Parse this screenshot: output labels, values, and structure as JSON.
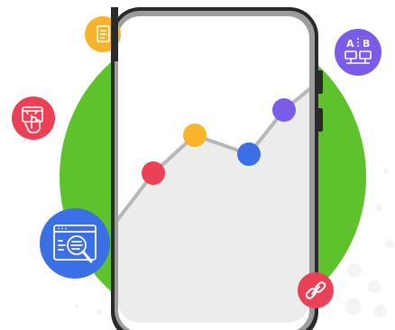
{
  "illustration": {
    "background_color": "#ffffff",
    "circle_color": "#5ec22d",
    "phone": {
      "frame_color": "#2a2a2a",
      "screen_color": "#ffffff",
      "chart_fill_color": "#ececec",
      "chart_line_color": "#b7b7b7",
      "chart_points": [
        {
          "color": "#ea4156"
        },
        {
          "color": "#f9b42a"
        },
        {
          "color": "#3a6fe6"
        },
        {
          "color": "#7a5ce8"
        }
      ]
    },
    "badges": [
      {
        "name": "document-badge",
        "icon": "document-icon",
        "color": "#f7b32b"
      },
      {
        "name": "ab-test-badge",
        "icon": "ab-test-monitors-icon",
        "color": "#7a5ce8",
        "label_a": "A",
        "label_b": "B"
      },
      {
        "name": "tap-badge",
        "icon": "hand-tap-icon",
        "color": "#ea4156"
      },
      {
        "name": "search-badge",
        "icon": "browser-search-icon",
        "color": "#3a6fe6"
      },
      {
        "name": "link-badge",
        "icon": "link-icon",
        "color": "#ea4156"
      }
    ]
  }
}
